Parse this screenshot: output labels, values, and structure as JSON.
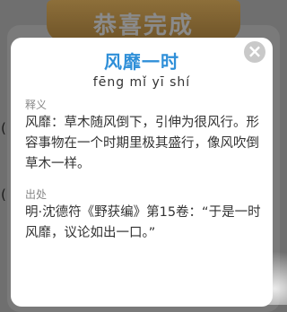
{
  "background": {
    "ribbon_title": "恭喜完成",
    "fragment_1": "(",
    "fragment_2": "("
  },
  "dialog": {
    "close_symbol": "×",
    "idiom": "风靡一时",
    "pinyin": "fēng mǐ yī shí",
    "meaning_label": "释义",
    "meaning_text": "风靡：草木随风倒下，引伸为很风行。形容事物在一个时期里极其盛行，像风吹倒草木一样。",
    "source_label": "出处",
    "source_text": "明·沈德符《野获编》第15卷：“于是一时风靡，议论如出一口。”"
  }
}
